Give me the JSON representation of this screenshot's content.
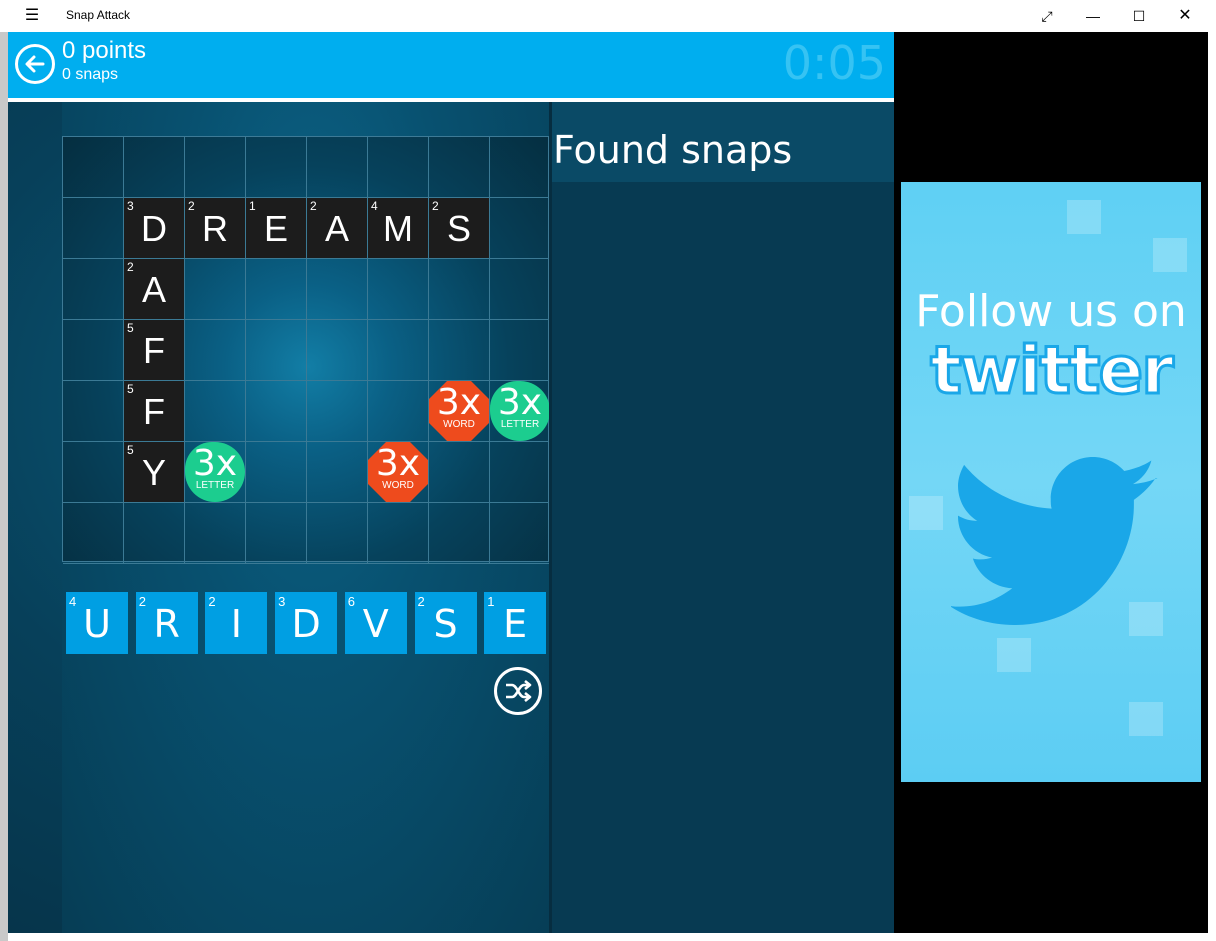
{
  "window": {
    "title": "Snap Attack",
    "menu_icon": "hamburger-icon",
    "controls": [
      "fullscreen-icon",
      "minimize-icon",
      "maximize-icon",
      "close-icon"
    ]
  },
  "header": {
    "points": "0 points",
    "snaps": "0 snaps",
    "timer": "0:05",
    "back_icon": "back-arrow-icon"
  },
  "board": {
    "rows": 7,
    "cols": 8,
    "letters": [
      {
        "row": 1,
        "col": 1,
        "letter": "D",
        "score": "3"
      },
      {
        "row": 1,
        "col": 2,
        "letter": "R",
        "score": "2"
      },
      {
        "row": 1,
        "col": 3,
        "letter": "E",
        "score": "1"
      },
      {
        "row": 1,
        "col": 4,
        "letter": "A",
        "score": "2"
      },
      {
        "row": 1,
        "col": 5,
        "letter": "M",
        "score": "4"
      },
      {
        "row": 1,
        "col": 6,
        "letter": "S",
        "score": "2"
      },
      {
        "row": 2,
        "col": 1,
        "letter": "A",
        "score": "2"
      },
      {
        "row": 3,
        "col": 1,
        "letter": "F",
        "score": "5"
      },
      {
        "row": 4,
        "col": 1,
        "letter": "F",
        "score": "5"
      },
      {
        "row": 5,
        "col": 1,
        "letter": "Y",
        "score": "5"
      }
    ],
    "bonuses": [
      {
        "row": 4,
        "col": 6,
        "type": "word",
        "big": "3x",
        "small": "WORD"
      },
      {
        "row": 4,
        "col": 7,
        "type": "letter",
        "big": "3x",
        "small": "LETTER"
      },
      {
        "row": 5,
        "col": 2,
        "type": "letter",
        "big": "3x",
        "small": "LETTER"
      },
      {
        "row": 5,
        "col": 5,
        "type": "word",
        "big": "3x",
        "small": "WORD"
      }
    ]
  },
  "rack": {
    "tiles": [
      {
        "letter": "U",
        "score": "4"
      },
      {
        "letter": "R",
        "score": "2"
      },
      {
        "letter": "I",
        "score": "2"
      },
      {
        "letter": "D",
        "score": "3"
      },
      {
        "letter": "V",
        "score": "6"
      },
      {
        "letter": "S",
        "score": "2"
      },
      {
        "letter": "E",
        "score": "1"
      }
    ],
    "shuffle_icon": "shuffle-icon"
  },
  "found": {
    "title": "Found snaps",
    "items": []
  },
  "ad": {
    "line1": "Follow us on",
    "line2": "twitter",
    "icon": "twitter-bird-icon"
  },
  "colors": {
    "header": "#00aeef",
    "tile": "#009fe3",
    "word_bonus": "#ee4b1d",
    "letter_bonus": "#1ccd8f",
    "board_letter": "#1c1c1c"
  }
}
